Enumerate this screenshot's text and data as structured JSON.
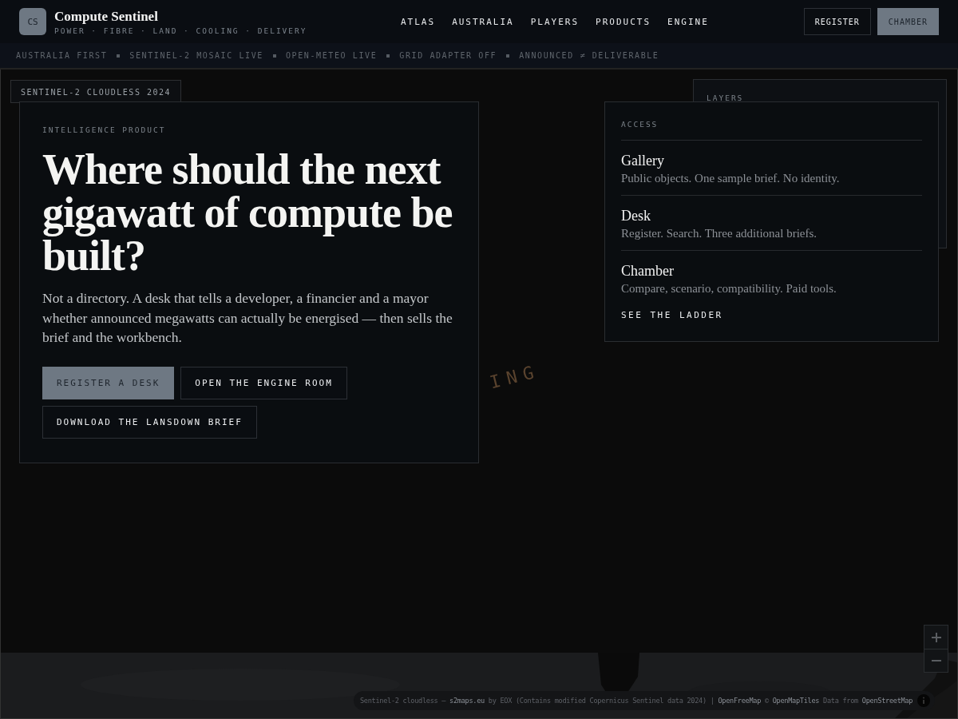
{
  "brand": {
    "mark": "CS",
    "name": "Compute Sentinel",
    "tagline": "POWER · FIBRE · LAND · COOLING · DELIVERY"
  },
  "nav": [
    {
      "label": "ATLAS"
    },
    {
      "label": "AUSTRALIA"
    },
    {
      "label": "PLAYERS"
    },
    {
      "label": "PRODUCTS"
    },
    {
      "label": "ENGINE"
    }
  ],
  "header_buttons": [
    {
      "label": "REGISTER",
      "kind": "outline"
    },
    {
      "label": "CHAMBER",
      "kind": "filled"
    }
  ],
  "ticker": [
    "AUSTRALIA FIRST",
    "SENTINEL-2 MOSAIC LIVE",
    "OPEN-METEO LIVE",
    "GRID ADAPTER OFF",
    "ANNOUNCED ≠ DELIVERABLE"
  ],
  "map": {
    "layer_badge": "SENTINEL-2 CLOUDLESS 2024",
    "overlay_text": "ING",
    "layers_title": "LAYERS",
    "attribution": [
      {
        "text": "Sentinel-2 cloudless — ",
        "kind": "text"
      },
      {
        "text": "s2maps.eu",
        "kind": "link"
      },
      {
        "text": " by EOX (Contains modified Copernicus Sentinel data 2024) | ",
        "kind": "text"
      },
      {
        "text": "OpenFreeMap",
        "kind": "link"
      },
      {
        "text": " © ",
        "kind": "text"
      },
      {
        "text": "OpenMapTiles",
        "kind": "link"
      },
      {
        "text": " Data from ",
        "kind": "text"
      },
      {
        "text": "OpenStreetMap",
        "kind": "link"
      }
    ]
  },
  "hero": {
    "eyebrow": "INTELLIGENCE PRODUCT",
    "headline": "Where should the next gigawatt of compute be built?",
    "body": "Not a directory. A desk that tells a developer, a financier and a mayor whether announced megawatts can actually be energised — then sells the brief and the workbench.",
    "buttons": [
      {
        "label": "REGISTER A DESK",
        "kind": "filled"
      },
      {
        "label": "OPEN THE ENGINE ROOM",
        "kind": "outline"
      },
      {
        "label": "DOWNLOAD THE LANSDOWN BRIEF",
        "kind": "outline"
      }
    ]
  },
  "access": {
    "title": "ACCESS",
    "tiers": [
      {
        "name": "Gallery",
        "description": "Public objects. One sample brief. No identity."
      },
      {
        "name": "Desk",
        "description": "Register. Search. Three additional briefs."
      },
      {
        "name": "Chamber",
        "description": "Compare, scenario, compatibility. Paid tools."
      }
    ],
    "link": "SEE THE LADDER"
  }
}
